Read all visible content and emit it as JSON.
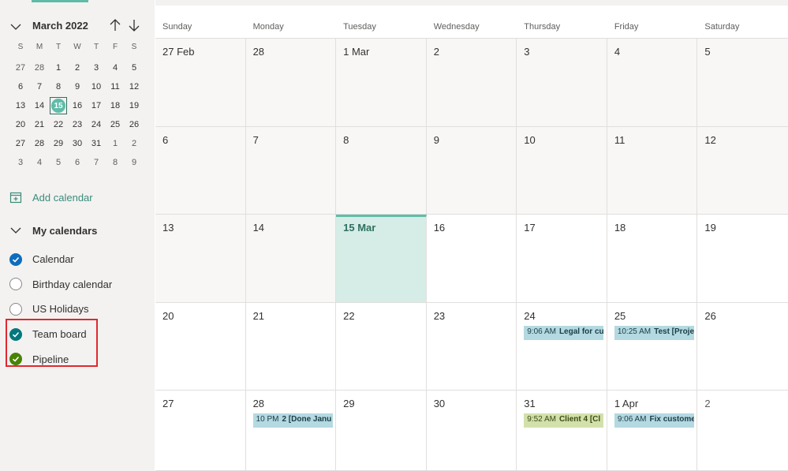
{
  "sidebar": {
    "month_label": "March 2022",
    "weekday_initials": [
      "S",
      "M",
      "T",
      "W",
      "T",
      "F",
      "S"
    ],
    "mini_weeks": [
      [
        {
          "d": "27",
          "other": true
        },
        {
          "d": "28",
          "other": true
        },
        {
          "d": "1"
        },
        {
          "d": "2"
        },
        {
          "d": "3"
        },
        {
          "d": "4"
        },
        {
          "d": "5"
        }
      ],
      [
        {
          "d": "6"
        },
        {
          "d": "7"
        },
        {
          "d": "8"
        },
        {
          "d": "9"
        },
        {
          "d": "10"
        },
        {
          "d": "11"
        },
        {
          "d": "12"
        }
      ],
      [
        {
          "d": "13"
        },
        {
          "d": "14"
        },
        {
          "d": "15",
          "today": true
        },
        {
          "d": "16"
        },
        {
          "d": "17"
        },
        {
          "d": "18"
        },
        {
          "d": "19"
        }
      ],
      [
        {
          "d": "20"
        },
        {
          "d": "21"
        },
        {
          "d": "22"
        },
        {
          "d": "23"
        },
        {
          "d": "24"
        },
        {
          "d": "25"
        },
        {
          "d": "26"
        }
      ],
      [
        {
          "d": "27"
        },
        {
          "d": "28"
        },
        {
          "d": "29"
        },
        {
          "d": "30"
        },
        {
          "d": "31"
        },
        {
          "d": "1",
          "other": true
        },
        {
          "d": "2",
          "other": true
        }
      ],
      [
        {
          "d": "3",
          "other": true
        },
        {
          "d": "4",
          "other": true
        },
        {
          "d": "5",
          "other": true
        },
        {
          "d": "6",
          "other": true
        },
        {
          "d": "7",
          "other": true
        },
        {
          "d": "8",
          "other": true
        },
        {
          "d": "9",
          "other": true
        }
      ]
    ],
    "add_calendar_label": "Add calendar",
    "my_calendars_label": "My calendars",
    "calendars": [
      {
        "label": "Calendar",
        "checked": true,
        "color": "#0f6cbd"
      },
      {
        "label": "Birthday calendar",
        "checked": false,
        "color": ""
      },
      {
        "label": "US Holidays",
        "checked": false,
        "color": ""
      },
      {
        "label": "Team board",
        "checked": true,
        "color": "#03787c"
      },
      {
        "label": "Pipeline",
        "checked": true,
        "color": "#498205"
      }
    ]
  },
  "calendar": {
    "day_headers": [
      "Sunday",
      "Monday",
      "Tuesday",
      "Wednesday",
      "Thursday",
      "Friday",
      "Saturday"
    ],
    "weeks": [
      [
        {
          "label": "27 Feb",
          "shaded": true
        },
        {
          "label": "28",
          "shaded": true
        },
        {
          "label": "1 Mar",
          "shaded": true
        },
        {
          "label": "2",
          "shaded": true
        },
        {
          "label": "3",
          "shaded": true
        },
        {
          "label": "4",
          "shaded": true
        },
        {
          "label": "5",
          "shaded": true
        }
      ],
      [
        {
          "label": "6",
          "shaded": true
        },
        {
          "label": "7",
          "shaded": true
        },
        {
          "label": "8",
          "shaded": true
        },
        {
          "label": "9",
          "shaded": true
        },
        {
          "label": "10",
          "shaded": true
        },
        {
          "label": "11",
          "shaded": true
        },
        {
          "label": "12",
          "shaded": true
        }
      ],
      [
        {
          "label": "13",
          "shaded": true
        },
        {
          "label": "14",
          "shaded": true
        },
        {
          "label": "15 Mar",
          "today": true
        },
        {
          "label": "16"
        },
        {
          "label": "17"
        },
        {
          "label": "18"
        },
        {
          "label": "19"
        }
      ],
      [
        {
          "label": "20"
        },
        {
          "label": "21"
        },
        {
          "label": "22"
        },
        {
          "label": "23"
        },
        {
          "label": "24",
          "event": {
            "time": "9:06 AM",
            "title": "Legal for cu",
            "style": "teal"
          }
        },
        {
          "label": "25",
          "event": {
            "time": "10:25 AM",
            "title": "Test [Proje",
            "style": "teal"
          }
        },
        {
          "label": "26"
        }
      ],
      [
        {
          "label": "27"
        },
        {
          "label": "28",
          "event": {
            "time": "10 PM",
            "title": "2 [Done Janu",
            "style": "teal"
          }
        },
        {
          "label": "29"
        },
        {
          "label": "30"
        },
        {
          "label": "31",
          "event": {
            "time": "9:52 AM",
            "title": "Client 4 [Cl",
            "style": "olive"
          }
        },
        {
          "label": "1 Apr",
          "event": {
            "time": "9:06 AM",
            "title": "Fix custome",
            "style": "teal"
          }
        },
        {
          "label": "2",
          "othermonth": true
        }
      ]
    ]
  },
  "colors": {
    "accent": "#5fbca8",
    "highlight_border": "#e0282e",
    "event_teal": "#b4d9e1",
    "event_olive": "#d2e1ab"
  }
}
